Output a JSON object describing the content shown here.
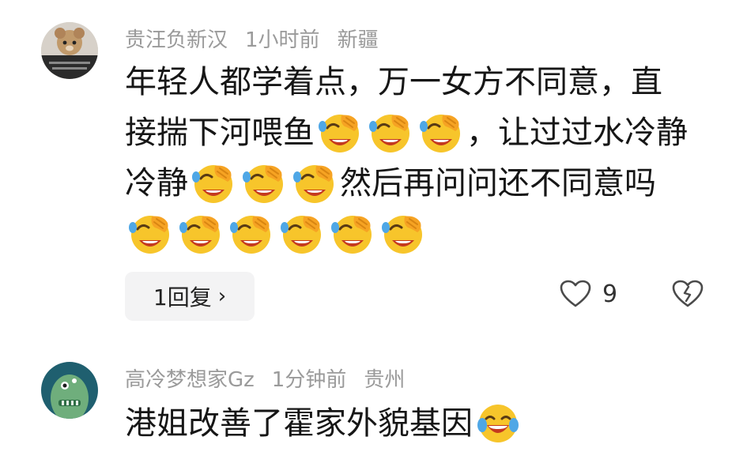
{
  "comments": [
    {
      "author": "贵汪负新汉",
      "time": "1小时前",
      "location": "新疆",
      "lines": [
        [
          "年轻人都学着点，万一女方不同意，直"
        ],
        [
          "接揣下河喂鱼",
          "emoji:face-holding-back-tears",
          "emoji:face-holding-back-tears",
          "emoji:face-holding-back-tears",
          "，让过过水冷静"
        ],
        [
          "冷静",
          "emoji:face-holding-back-tears",
          "emoji:face-holding-back-tears",
          "emoji:face-holding-back-tears",
          "然后再问问还不同意吗"
        ],
        [
          "emoji:face-holding-back-tears",
          "emoji:face-holding-back-tears",
          "emoji:face-holding-back-tears",
          "emoji:face-holding-back-tears",
          "emoji:face-holding-back-tears",
          "emoji:face-holding-back-tears"
        ]
      ],
      "reply_button": "1回复",
      "reply_chevron": "›",
      "like_count": "9",
      "icons": {
        "like": "heart-outline-icon",
        "dislike": "broken-heart-icon"
      }
    },
    {
      "author": "高冷梦想家Gz",
      "time": "1分钟前",
      "location": "贵州",
      "text": "港姐改善了霍家外貌基因",
      "trailing_emoji": "emoji:face-with-tears-of-joy"
    }
  ],
  "colors": {
    "meta": "#9a9a9a",
    "text": "#161616",
    "reply_bg": "#f3f3f4",
    "emoji_yellow": "#f7c52b",
    "emoji_mouth": "#c4391f"
  }
}
